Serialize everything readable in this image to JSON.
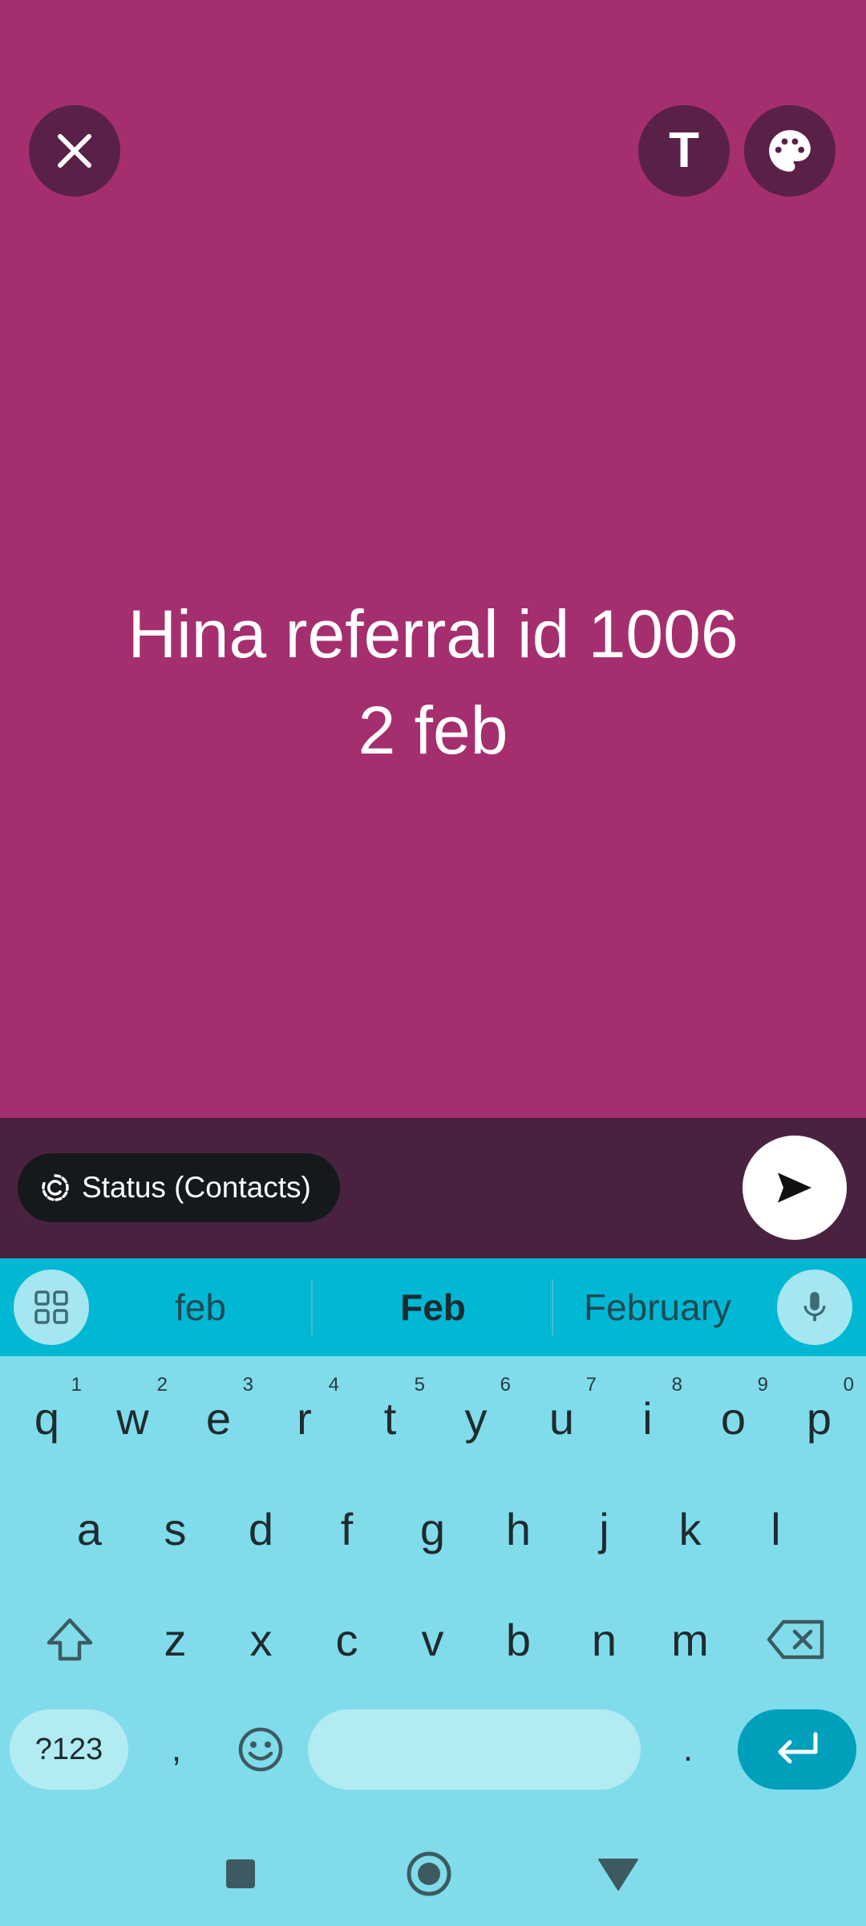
{
  "composer": {
    "background_color": "#a52f6e",
    "text_lines": [
      "Hina referral id 1006",
      "2 feb"
    ],
    "close_icon": "close-icon",
    "text_button_label": "T",
    "palette_icon": "palette-icon"
  },
  "bottom_bar": {
    "privacy_label": "Status (Contacts)",
    "privacy_icon": "status-circle-icon",
    "send_icon": "send-icon"
  },
  "keyboard": {
    "suggestions": [
      "feb",
      "Feb",
      "February"
    ],
    "apps_icon": "apps-grid-icon",
    "mic_icon": "microphone-icon",
    "row1": [
      {
        "key": "q",
        "hint": "1"
      },
      {
        "key": "w",
        "hint": "2"
      },
      {
        "key": "e",
        "hint": "3"
      },
      {
        "key": "r",
        "hint": "4"
      },
      {
        "key": "t",
        "hint": "5"
      },
      {
        "key": "y",
        "hint": "6"
      },
      {
        "key": "u",
        "hint": "7"
      },
      {
        "key": "i",
        "hint": "8"
      },
      {
        "key": "o",
        "hint": "9"
      },
      {
        "key": "p",
        "hint": "0"
      }
    ],
    "row2": [
      "a",
      "s",
      "d",
      "f",
      "g",
      "h",
      "j",
      "k",
      "l"
    ],
    "row3": [
      "z",
      "x",
      "c",
      "v",
      "b",
      "n",
      "m"
    ],
    "shift_icon": "shift-icon",
    "backspace_icon": "backspace-icon",
    "symbols_label": "?123",
    "comma_label": ",",
    "emoji_icon": "emoji-icon",
    "period_label": ".",
    "enter_icon": "enter-icon"
  },
  "nav_bar": {
    "recents_icon": "recents-square-icon",
    "home_icon": "home-circle-icon",
    "back_icon": "back-triangle-icon"
  }
}
